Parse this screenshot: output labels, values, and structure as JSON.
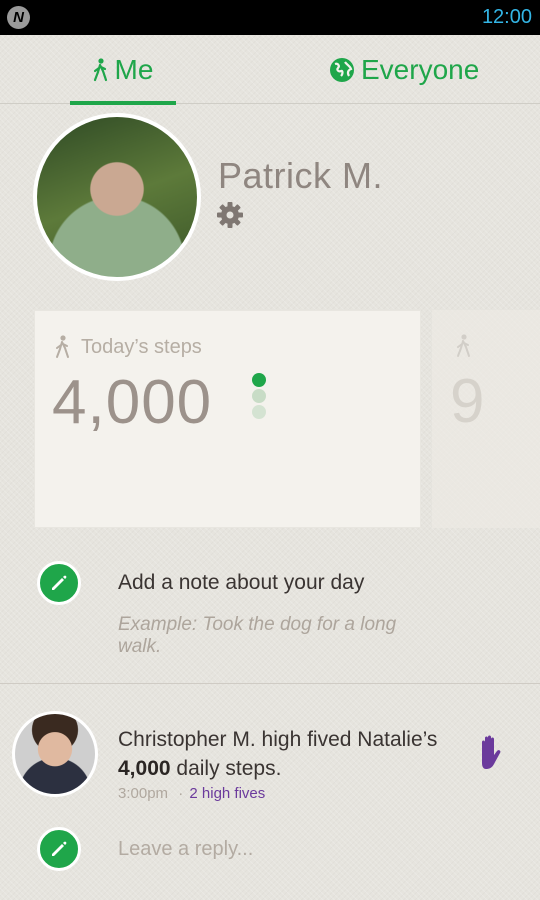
{
  "status_bar": {
    "app_logo": "N",
    "time": "12:00"
  },
  "tabs": [
    {
      "label": "Me",
      "icon": "walker-icon",
      "selected": true
    },
    {
      "label": "Everyone",
      "icon": "globe-icon",
      "selected": false
    }
  ],
  "profile": {
    "name": "Patrick M.",
    "settings_icon": "gear-icon"
  },
  "steps_card": {
    "label": "Today’s steps",
    "value": "4,000",
    "level_dots": 3,
    "active_dots": 1
  },
  "peek_card": {
    "value": "9"
  },
  "note": {
    "title": "Add a note about your day",
    "example": "Example: Took the dog for a long walk."
  },
  "activity": {
    "text_before": "Christopher M. high fived Natalie’s ",
    "steps": "4,000",
    "text_after": " daily steps.",
    "time": "3:00pm",
    "separator": "·",
    "high_fives": "2 high fives"
  },
  "reply": {
    "placeholder": "Leave a reply..."
  },
  "colors": {
    "accent_green": "#1fa64a",
    "status_blue": "#33b5e5",
    "high_five_purple": "#6b3a9c"
  }
}
